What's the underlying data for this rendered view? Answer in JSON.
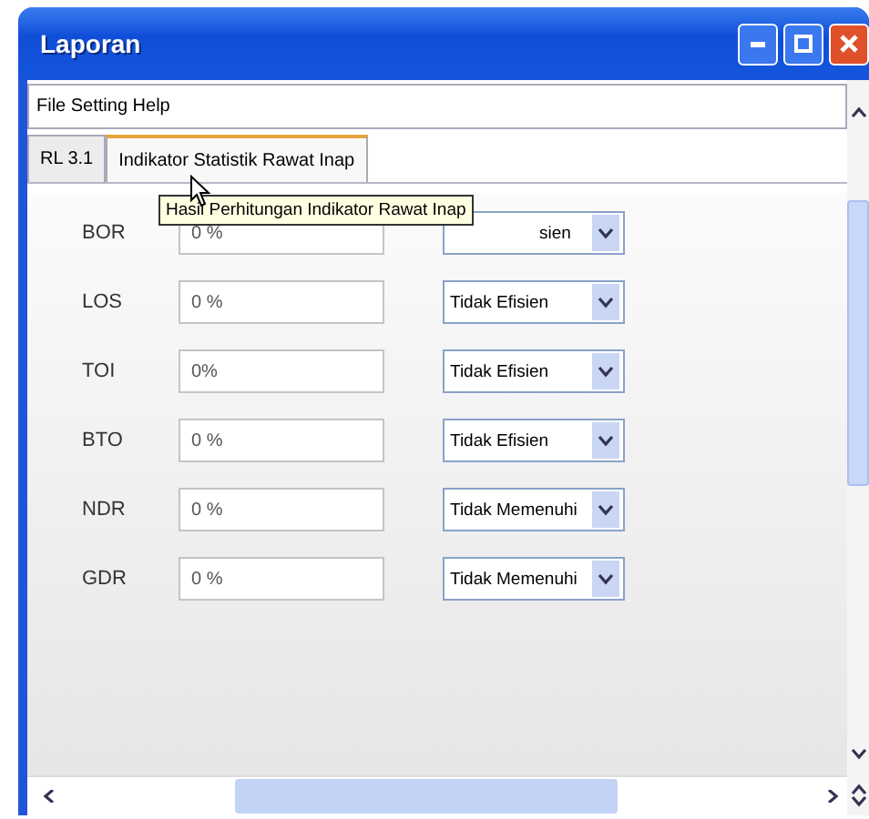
{
  "window": {
    "title": "Laporan"
  },
  "menu_bar": {
    "text": "File Setting Help"
  },
  "tabs": [
    {
      "label": "RL 3.1",
      "selected": false
    },
    {
      "label": "Indikator Statistik Rawat Inap",
      "selected": true
    }
  ],
  "tooltip": {
    "text": "Hasil Perhitungan Indikator Rawat Inap"
  },
  "indicators": [
    {
      "name": "BOR",
      "value": "0 %",
      "status": "sien",
      "partly_hidden": true
    },
    {
      "name": "LOS",
      "value": "0 %",
      "status": "Tidak Efisien",
      "partly_hidden": false
    },
    {
      "name": "TOI",
      "value": "0%",
      "status": "Tidak Efisien",
      "partly_hidden": false
    },
    {
      "name": "BTO",
      "value": "0 %",
      "status": "Tidak Efisien",
      "partly_hidden": false
    },
    {
      "name": "NDR",
      "value": "0 %",
      "status": "Tidak Memenuhi",
      "partly_hidden": false
    },
    {
      "name": "GDR",
      "value": "0 %",
      "status": "Tidak Memenuhi",
      "partly_hidden": false
    }
  ]
}
